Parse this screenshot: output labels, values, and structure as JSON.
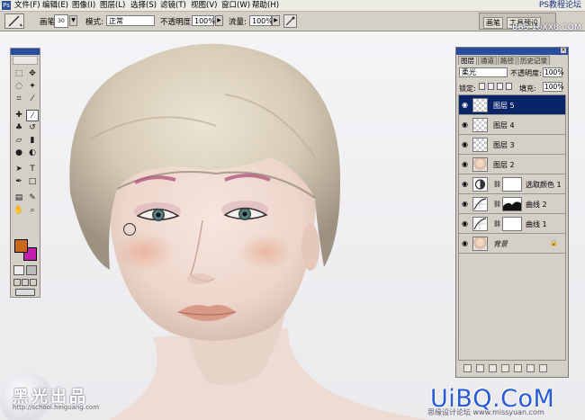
{
  "menubar": {
    "items": [
      "文件(F)",
      "编辑(E)",
      "图像(I)",
      "图层(L)",
      "选择(S)",
      "滤镜(T)",
      "视图(V)",
      "窗口(W)",
      "帮助(H)"
    ],
    "site_tag": "PS教程论坛",
    "site_tag2": "BBS.16XX8.COM"
  },
  "options": {
    "brush_label": "画笔:",
    "brush_size": "30",
    "mode_label": "模式:",
    "mode_value": "正常",
    "opacity_label": "不透明度:",
    "opacity_value": "100%",
    "flow_label": "流量:",
    "flow_value": "100%",
    "docked_tabs": [
      "画笔",
      "工具预设"
    ]
  },
  "toolbox": {
    "tools": [
      "move-icon",
      "marquee-icon",
      "lasso-icon",
      "magic-wand-icon",
      "crop-icon",
      "slice-icon",
      "healing-brush-icon",
      "brush-icon",
      "clone-stamp-icon",
      "history-brush-icon",
      "eraser-icon",
      "gradient-icon",
      "blur-icon",
      "dodge-icon",
      "path-select-icon",
      "type-icon",
      "pen-icon",
      "shape-icon",
      "notes-icon",
      "eyedropper-icon",
      "hand-icon",
      "zoom-icon"
    ],
    "foreground_color": "#c8681a",
    "background_color": "#c01cb0"
  },
  "layers_panel": {
    "tabs": [
      "图层",
      "通道",
      "路径",
      "历史记录"
    ],
    "blend_mode": "柔光",
    "opacity_label": "不透明度:",
    "opacity_value": "100%",
    "lock_label": "锁定:",
    "fill_label": "填充:",
    "fill_value": "100%",
    "layers": [
      {
        "name": "图层 5",
        "selected": true,
        "kind": "pixel"
      },
      {
        "name": "图层 4",
        "selected": false,
        "kind": "pixel"
      },
      {
        "name": "图层 3",
        "selected": false,
        "kind": "pixel"
      },
      {
        "name": "图层 2",
        "selected": false,
        "kind": "photo"
      },
      {
        "name": "选取颜色 1",
        "selected": false,
        "kind": "adjustment"
      },
      {
        "name": "曲线 2",
        "selected": false,
        "kind": "adjustment"
      },
      {
        "name": "曲线 1",
        "selected": false,
        "kind": "adjustment"
      },
      {
        "name": "背景",
        "selected": false,
        "kind": "photo"
      }
    ]
  },
  "watermarks": {
    "left": "黑光出品",
    "left_url": "http://school.heiguang.com",
    "right": "UiBQ.CoM",
    "right_sub": "思缘设计论坛 www.missyuan.com"
  },
  "colors": {
    "selection": "#0a246a",
    "title_bar": "#2a4ca0",
    "chrome": "#d4d0c8"
  }
}
